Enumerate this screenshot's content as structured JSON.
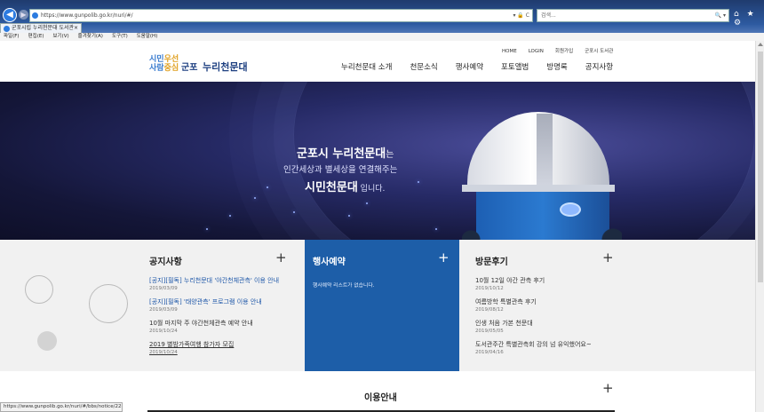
{
  "browser": {
    "url": "https://www.gunpolib.go.kr/nuri/#/",
    "addr_controls": "▾ 🔒 C",
    "search_placeholder": "검색...",
    "search_controls": "🔍 ▾",
    "tab_title": "군포시립 누리천문대 도서관",
    "tab_close": "×",
    "menu": [
      "파일(F)",
      "편집(E)",
      "보기(V)",
      "즐겨찾기(A)",
      "도구(T)",
      "도움말(H)"
    ],
    "toolbar_icons": "⌂ ★ ⚙",
    "status_url": "https://www.gunpolib.go.kr/nuri/#/bbs/notice/22837"
  },
  "header": {
    "logo_line1_a": "시민",
    "logo_line1_b": "우선",
    "logo_line2_a": "사람",
    "logo_line2_b": "중심",
    "logo_city": "군포",
    "logo_title": "누리천문대",
    "toplinks": [
      "HOME",
      "LOGIN",
      "회원가입",
      "군포시 도서관"
    ],
    "gnb": [
      "누리천문대 소개",
      "천문소식",
      "행사예약",
      "포토앨범",
      "방명록",
      "공지사항"
    ]
  },
  "hero": {
    "line1_bold": "군포시 누리천문대",
    "line1_rest": "는",
    "line2": "인간세상과 별세상을 연결해주는",
    "line3_bold": "시민천문대",
    "line3_rest": " 입니다."
  },
  "boards": {
    "notice": {
      "title": "공지사항",
      "more": "+",
      "items": [
        {
          "text": "[공지][필독] 누리천문대 '야간천체관측' 이용 안내",
          "date": "2019/03/09"
        },
        {
          "text": "[공지][필독] '태양관측' 프로그램 이용 안내",
          "date": "2019/03/09"
        },
        {
          "text": "10월 마지막 주 야간천체관측 예약 안내",
          "date": "2019/10/24"
        },
        {
          "text": "2019 별밤가족여행 참가자 모집",
          "date": "2019/10/24"
        }
      ]
    },
    "reservation": {
      "title": "행사예약",
      "more": "+",
      "empty": "행사예약 리스트가 없습니다."
    },
    "review": {
      "title": "방문후기",
      "more": "+",
      "items": [
        {
          "text": "10월 12일 야간 관측 후기",
          "date": "2019/10/12"
        },
        {
          "text": "여름방학 특별관측 후기",
          "date": "2019/08/12"
        },
        {
          "text": "인생 처음 가본 천문대",
          "date": "2019/05/05"
        },
        {
          "text": "도서관주간 특별관측회 강의 넘 유익했어요~",
          "date": "2019/04/16"
        }
      ]
    }
  },
  "usage": {
    "title": "이용안내",
    "more": "+"
  }
}
